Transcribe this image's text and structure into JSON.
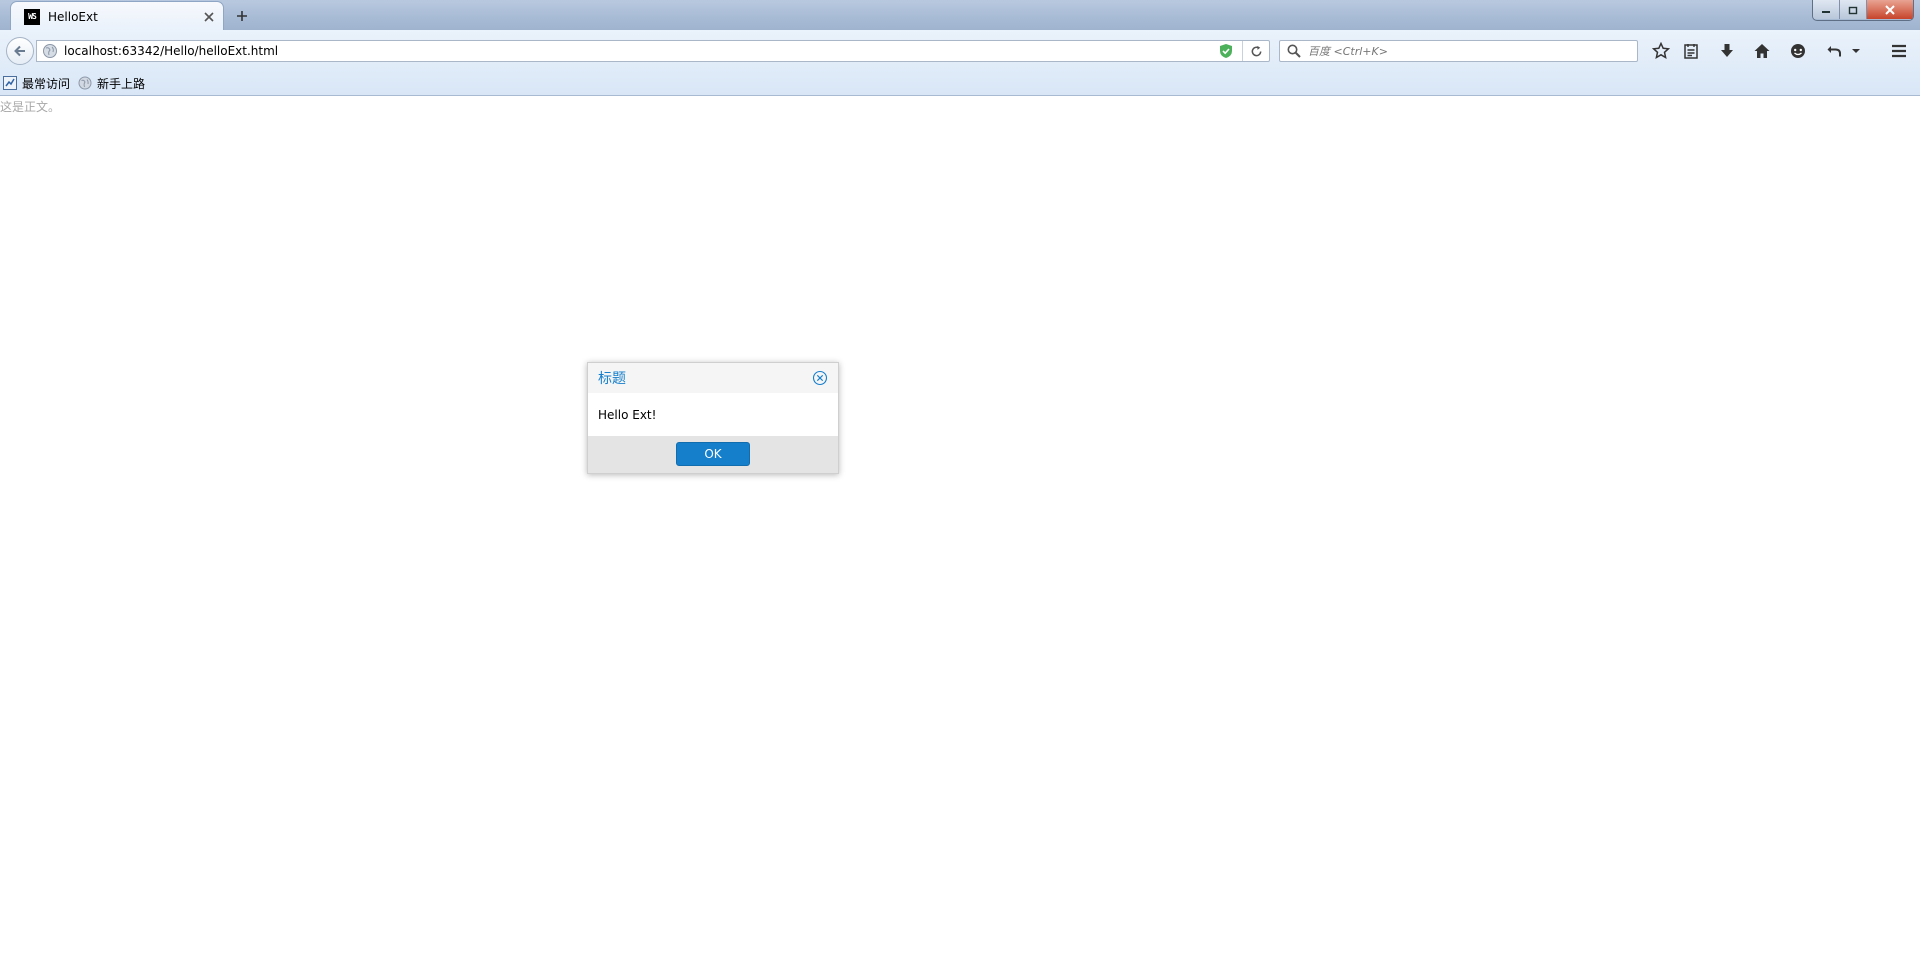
{
  "browser": {
    "tab": {
      "title": "HelloExt",
      "favicon_text": "WS"
    },
    "url": "localhost:63342/Hello/helloExt.html",
    "search": {
      "placeholder": "百度 <Ctrl+K>"
    },
    "toolbar_icons": [
      "star-icon",
      "reading-list-icon",
      "download-icon",
      "home-icon",
      "chat-icon",
      "undo-icon",
      "dropdown-arrow-icon",
      "menu-icon"
    ]
  },
  "bookmarks": {
    "items": [
      {
        "label": "最常访问",
        "icon": "most-visited-icon"
      },
      {
        "label": "新手上路",
        "icon": "globe-icon"
      }
    ]
  },
  "page": {
    "body_text": "这是正文。"
  },
  "dialog": {
    "title": "标题",
    "message": "Hello Ext!",
    "ok_label": "OK",
    "accent_color": "#157fcc"
  }
}
